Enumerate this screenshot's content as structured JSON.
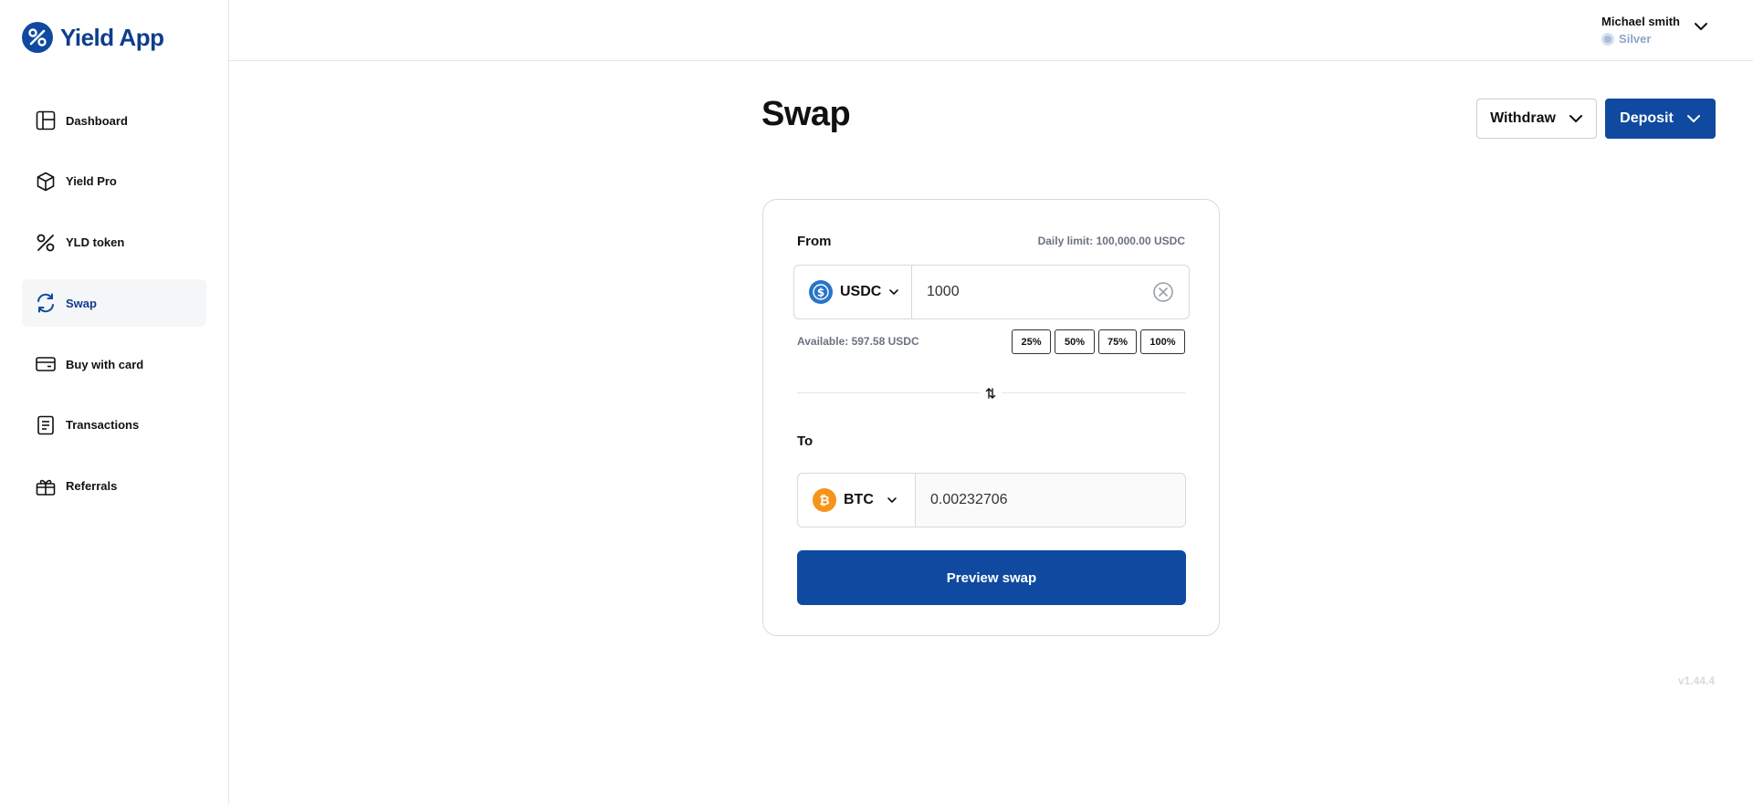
{
  "app": {
    "name": "Yield App"
  },
  "colors": {
    "brand": "#0f4aa0",
    "bitcoin": "#f7931a",
    "usdc": "#2775ca"
  },
  "sidebar": {
    "items": [
      {
        "label": "Dashboard",
        "icon": "dashboard-icon"
      },
      {
        "label": "Yield Pro",
        "icon": "cube-icon"
      },
      {
        "label": "YLD token",
        "icon": "percent-icon"
      },
      {
        "label": "Swap",
        "icon": "swap-refresh-icon",
        "active": true
      },
      {
        "label": "Buy with card",
        "icon": "credit-card-icon"
      },
      {
        "label": "Transactions",
        "icon": "document-icon"
      },
      {
        "label": "Referrals",
        "icon": "gift-icon"
      }
    ]
  },
  "header": {
    "user_name": "Michael smith",
    "user_tier": "Silver"
  },
  "page": {
    "title": "Swap",
    "withdraw_label": "Withdraw",
    "deposit_label": "Deposit"
  },
  "swap": {
    "from_label": "From",
    "daily_limit": "Daily limit: 100,000.00 USDC",
    "from_coin": "USDC",
    "from_amount": "1000",
    "available": "Available: 597.58 USDC",
    "percent_options": [
      "25%",
      "50%",
      "75%",
      "100%"
    ],
    "to_label": "To",
    "to_coin": "BTC",
    "to_amount": "0.00232706",
    "preview_label": "Preview swap"
  },
  "version": "v1.44.4"
}
